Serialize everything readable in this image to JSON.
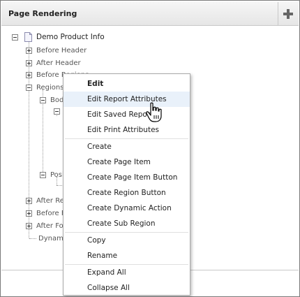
{
  "panel": {
    "title": "Page Rendering",
    "add_icon": "plus-icon"
  },
  "tree": {
    "root": "Demo Product Info",
    "before_header": "Before Header",
    "after_header": "After Header",
    "before_regions": "Before Regions",
    "regions": "Regions",
    "body": "Body",
    "position": "Position",
    "after_regions": "After Regions",
    "before_footer": "Before Footer",
    "after_footer": "After Footer",
    "dynamic_actions": "Dynamic Actions"
  },
  "context_menu": {
    "items": [
      "Edit",
      "Edit Report Attributes",
      "Edit Saved Reports",
      "Edit Print Attributes",
      "Create",
      "Create Page Item",
      "Create Page Item Button",
      "Create Region Button",
      "Create Dynamic Action",
      "Create Sub Region",
      "Copy",
      "Rename",
      "Expand All",
      "Collapse All"
    ]
  },
  "colors": {
    "menu_highlight": "#e9f1fa",
    "border": "#a9a9a9"
  }
}
